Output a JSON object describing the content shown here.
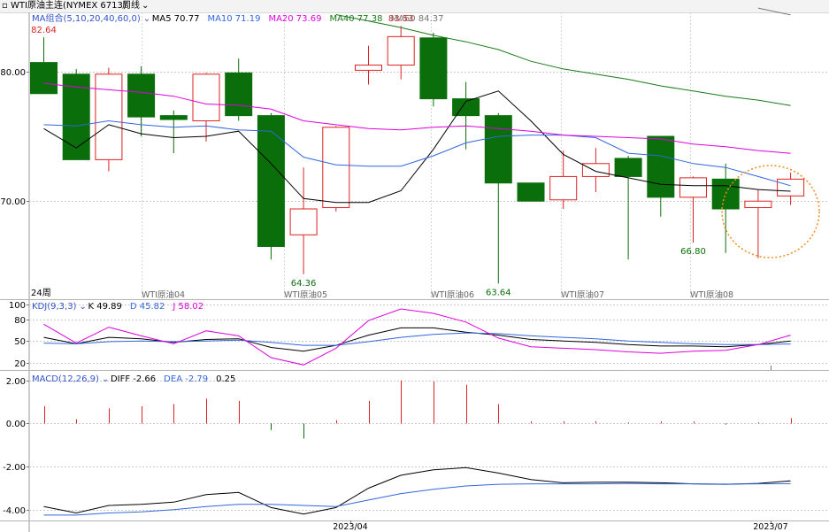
{
  "toolbar": {
    "title": "WTI原油主连(NYMEX 6713)",
    "period": "周线",
    "collapse_icon": "small-square-icon",
    "dropdown_icon": "chevron-down-icon"
  },
  "legend_main": {
    "group": "MA组合(5,10,20,40,60,0)",
    "items": [
      {
        "label": "MA5",
        "value": "70.77",
        "color": "#000000"
      },
      {
        "label": "MA10",
        "value": "71.19",
        "color": "#3366dd"
      },
      {
        "label": "MA20",
        "value": "73.69",
        "color": "#dd00dd"
      },
      {
        "label": "MA40",
        "value": "77.38",
        "color": "#1a7a1a"
      },
      {
        "label": "MA60",
        "value": "84.37",
        "color": "#777777"
      }
    ]
  },
  "legend_kdj": {
    "group": "KDJ(9,3,3)",
    "items": [
      {
        "label": "K",
        "value": "49.89",
        "color": "#000000"
      },
      {
        "label": "D",
        "value": "45.82",
        "color": "#3366dd"
      },
      {
        "label": "J",
        "value": "58.02",
        "color": "#dd00dd"
      }
    ]
  },
  "legend_macd": {
    "group": "MACD(12,26,9)",
    "items": [
      {
        "label": "DIFF",
        "value": "-2.66",
        "color": "#000000"
      },
      {
        "label": "DEA",
        "value": "-2.79",
        "color": "#3366dd"
      },
      {
        "label": "",
        "value": "0.25",
        "color": "#000000"
      }
    ]
  },
  "period_marker": "24周",
  "contract_labels": [
    "WTI原油04",
    "WTI原油05",
    "WTI原油06",
    "WTI原油07",
    "WTI原油08"
  ],
  "date_labels": [
    "2023/04",
    "2023/07"
  ],
  "colors": {
    "up": "#dd2222",
    "down": "#0a6e0a",
    "highlight": "#f08c1e",
    "grid": "#c8c8c8"
  },
  "chart_data": [
    {
      "type": "candlestick",
      "panel": "price",
      "yticks": [
        70.0,
        80.0
      ],
      "ylim": [
        62.5,
        84.5
      ],
      "candles": [
        {
          "open": 80.7,
          "high": 82.64,
          "low": 79.3,
          "close": 78.3
        },
        {
          "open": 79.8,
          "high": 80.2,
          "low": 73.2,
          "close": 73.2
        },
        {
          "open": 73.2,
          "high": 80.3,
          "low": 72.3,
          "close": 79.8
        },
        {
          "open": 79.8,
          "high": 80.4,
          "low": 75.0,
          "close": 76.5
        },
        {
          "open": 76.6,
          "high": 77.0,
          "low": 73.7,
          "close": 76.3
        },
        {
          "open": 76.2,
          "high": 79.9,
          "low": 74.6,
          "close": 79.8
        },
        {
          "open": 79.9,
          "high": 81.0,
          "low": 76.2,
          "close": 76.6
        },
        {
          "open": 76.6,
          "high": 76.8,
          "low": 65.5,
          "close": 66.5
        },
        {
          "open": 67.4,
          "high": 72.6,
          "low": 64.36,
          "close": 69.4
        },
        {
          "open": 69.5,
          "high": 75.8,
          "low": 69.2,
          "close": 75.7
        },
        {
          "open": 80.1,
          "high": 82.0,
          "low": 79.0,
          "close": 80.5
        },
        {
          "open": 80.5,
          "high": 83.53,
          "low": 79.4,
          "close": 82.7
        },
        {
          "open": 82.6,
          "high": 83.0,
          "low": 77.3,
          "close": 77.9
        },
        {
          "open": 77.9,
          "high": 79.2,
          "low": 74.0,
          "close": 76.6
        },
        {
          "open": 76.6,
          "high": 76.8,
          "low": 63.64,
          "close": 71.4
        },
        {
          "open": 71.4,
          "high": 71.4,
          "low": 70.0,
          "close": 70.0
        },
        {
          "open": 70.1,
          "high": 73.9,
          "low": 69.4,
          "close": 71.9
        },
        {
          "open": 71.9,
          "high": 74.1,
          "low": 70.7,
          "close": 72.9
        },
        {
          "open": 73.3,
          "high": 73.5,
          "low": 65.5,
          "close": 71.9
        },
        {
          "open": 75.0,
          "high": 75.0,
          "low": 68.8,
          "close": 70.3
        },
        {
          "open": 70.3,
          "high": 71.9,
          "low": 66.8,
          "close": 71.8
        },
        {
          "open": 71.7,
          "high": 72.9,
          "low": 66.0,
          "close": 69.4
        },
        {
          "open": 69.5,
          "high": 70.9,
          "low": 65.6,
          "close": 70.0
        },
        {
          "open": 70.4,
          "high": 72.2,
          "low": 69.7,
          "close": 71.7
        }
      ],
      "ma": {
        "MA5": [
          75.6,
          74.1,
          75.9,
          75.2,
          74.9,
          75.0,
          75.4,
          72.9,
          70.2,
          69.9,
          69.9,
          70.8,
          74.0,
          77.7,
          78.5,
          76.2,
          73.6,
          72.3,
          71.8,
          71.3,
          71.2,
          71.2,
          70.9,
          70.77
        ],
        "MA10": [
          75.9,
          75.8,
          76.2,
          75.9,
          75.7,
          75.8,
          75.5,
          75.4,
          73.4,
          72.8,
          72.7,
          72.7,
          73.5,
          74.5,
          75.0,
          75.1,
          75.1,
          74.9,
          73.7,
          73.5,
          72.9,
          72.6,
          71.9,
          71.19
        ],
        "MA20": [
          79.1,
          78.8,
          78.6,
          78.4,
          78.1,
          77.5,
          77.4,
          77.1,
          76.2,
          75.9,
          75.6,
          75.5,
          75.7,
          75.8,
          75.6,
          75.4,
          75.1,
          75.0,
          74.9,
          74.8,
          74.4,
          74.2,
          73.9,
          73.69
        ],
        "MA40": [
          null,
          null,
          null,
          null,
          null,
          null,
          null,
          null,
          null,
          84.4,
          83.9,
          83.4,
          82.8,
          82.3,
          81.7,
          80.8,
          80.2,
          79.8,
          79.4,
          78.9,
          78.5,
          78.1,
          77.8,
          77.38
        ],
        "MA60": [
          null,
          null,
          null,
          null,
          null,
          null,
          null,
          null,
          null,
          null,
          null,
          null,
          null,
          null,
          null,
          null,
          null,
          null,
          null,
          null,
          null,
          null,
          84.9,
          84.37
        ]
      },
      "annotations": [
        {
          "text": "82.64",
          "candle": 0,
          "kind": "high"
        },
        {
          "text": "64.36",
          "candle": 8,
          "kind": "low"
        },
        {
          "text": "83.53",
          "candle": 11,
          "kind": "high"
        },
        {
          "text": "63.64",
          "candle": 14,
          "kind": "low"
        },
        {
          "text": "66.80",
          "candle": 20,
          "kind": "low"
        }
      ]
    },
    {
      "type": "line",
      "panel": "kdj",
      "yticks": [
        20,
        50,
        80,
        100
      ],
      "ylim": [
        10,
        105
      ],
      "series": [
        {
          "name": "K",
          "values": [
            55,
            46,
            55,
            53,
            48,
            52,
            53,
            41,
            36,
            44,
            58,
            68,
            68,
            62,
            58,
            52,
            50,
            48,
            45,
            43,
            43,
            42,
            45,
            49.89
          ]
        },
        {
          "name": "D",
          "values": [
            47,
            46,
            49,
            50,
            49,
            50,
            51,
            48,
            44,
            44,
            49,
            55,
            59,
            61,
            60,
            57,
            55,
            53,
            50,
            48,
            46,
            45,
            45,
            45.82
          ]
        },
        {
          "name": "J",
          "values": [
            73,
            47,
            69,
            57,
            46,
            64,
            57,
            27,
            17,
            40,
            78,
            94,
            88,
            76,
            54,
            42,
            40,
            38,
            35,
            33,
            36,
            37,
            45,
            58.02
          ]
        }
      ]
    },
    {
      "type": "bar+line",
      "panel": "macd",
      "yticks": [
        -4.0,
        -2.0,
        0.0,
        2.0
      ],
      "ylim": [
        -4.5,
        2.4
      ],
      "macd": [
        0.8,
        0.2,
        0.7,
        0.8,
        0.9,
        1.15,
        1.05,
        -0.3,
        -0.7,
        0.15,
        1.05,
        2.0,
        1.95,
        1.8,
        0.9,
        0.1,
        0.1,
        0.1,
        0.05,
        0.1,
        0.1,
        -0.05,
        0.05,
        0.25
      ],
      "series": [
        {
          "name": "DIFF",
          "values": [
            -3.85,
            -4.15,
            -3.8,
            -3.75,
            -3.65,
            -3.3,
            -3.2,
            -3.9,
            -4.2,
            -3.9,
            -3.0,
            -2.4,
            -2.15,
            -2.05,
            -2.3,
            -2.6,
            -2.75,
            -2.72,
            -2.72,
            -2.75,
            -2.8,
            -2.82,
            -2.78,
            -2.66
          ]
        },
        {
          "name": "DEA",
          "values": [
            -4.25,
            -4.25,
            -4.15,
            -4.1,
            -4.0,
            -3.85,
            -3.75,
            -3.75,
            -3.8,
            -3.85,
            -3.55,
            -3.25,
            -3.05,
            -2.9,
            -2.82,
            -2.8,
            -2.8,
            -2.8,
            -2.78,
            -2.8,
            -2.8,
            -2.81,
            -2.8,
            -2.79
          ]
        }
      ]
    }
  ]
}
